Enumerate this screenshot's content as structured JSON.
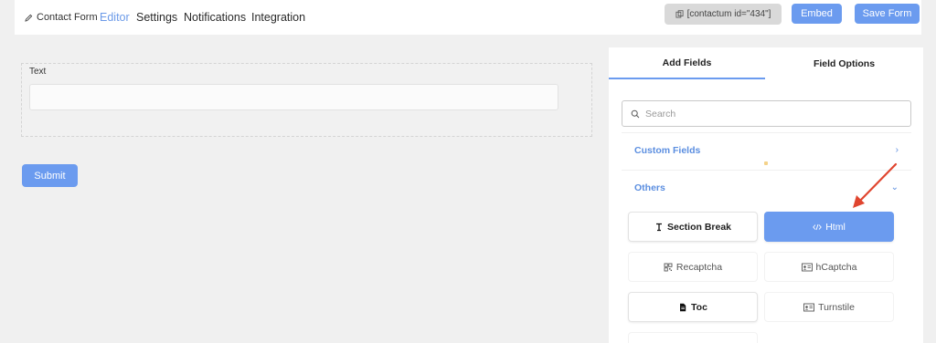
{
  "header": {
    "breadcrumb": "Contact Form",
    "nav": [
      "Editor",
      "Settings",
      "Notifications",
      "Integration"
    ],
    "shortcode": "[contactum id=\"434\"]",
    "embed_label": "Embed",
    "save_label": "Save Form"
  },
  "canvas": {
    "field_label": "Text",
    "submit_label": "Submit"
  },
  "panel": {
    "tabs": [
      "Add Fields",
      "Field Options"
    ],
    "search_placeholder": "Search",
    "sections": [
      {
        "title": "Custom Fields",
        "state": "collapsed"
      },
      {
        "title": "Others",
        "state": "expanded"
      }
    ],
    "fields": [
      {
        "label": "Section Break",
        "icon": "text-cursor-icon"
      },
      {
        "label": "Html",
        "icon": "code-icon"
      },
      {
        "label": "Recaptcha",
        "icon": "qr-icon"
      },
      {
        "label": "hCaptcha",
        "icon": "id-card-icon"
      },
      {
        "label": "Toc",
        "icon": "document-icon"
      },
      {
        "label": "Turnstile",
        "icon": "id-card-icon"
      }
    ]
  },
  "colors": {
    "accent": "#6b9bef",
    "link": "#5b8ee0",
    "arrow": "#e0452f"
  }
}
